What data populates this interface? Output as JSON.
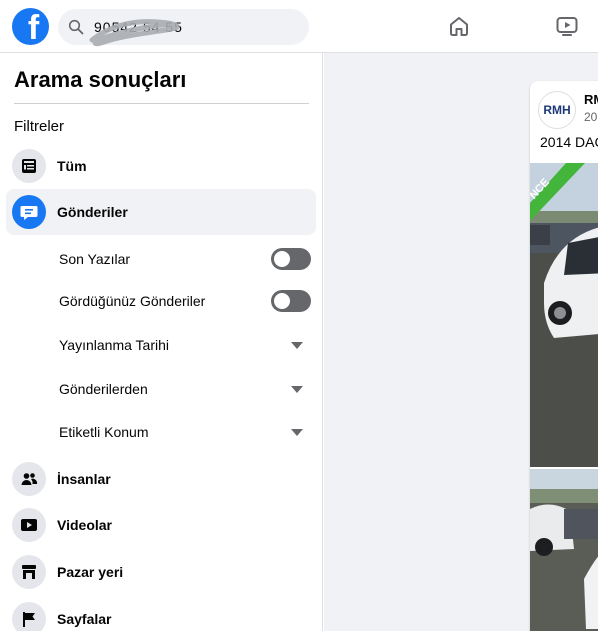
{
  "topbar": {
    "logo_letter": "f",
    "search_value": "90542 54 55"
  },
  "sidebar": {
    "title": "Arama sonuçları",
    "filters_label": "Filtreler",
    "categories": [
      {
        "label": "Tüm",
        "icon": "feed-icon"
      },
      {
        "label": "Gönderiler",
        "icon": "posts-icon",
        "active": true
      },
      {
        "label": "İnsanlar",
        "icon": "people-icon"
      },
      {
        "label": "Videolar",
        "icon": "video-icon"
      },
      {
        "label": "Pazar yeri",
        "icon": "marketplace-icon"
      },
      {
        "label": "Sayfalar",
        "icon": "flag-icon"
      }
    ],
    "sub_filters": [
      {
        "label": "Son Yazılar",
        "control": "toggle",
        "on": false
      },
      {
        "label": "Gördüğünüz Gönderiler",
        "control": "toggle",
        "on": false
      },
      {
        "label": "Yayınlanma Tarihi",
        "control": "dropdown"
      },
      {
        "label": "Gönderilerden",
        "control": "dropdown"
      },
      {
        "label": "Etiketli Konum",
        "control": "dropdown"
      }
    ]
  },
  "post": {
    "avatar_text": "RMH",
    "author": "RM",
    "date": "20",
    "text": "2014 DAC",
    "banner_text": "NCE"
  },
  "colors": {
    "brand": "#1877f2",
    "toggle_off": "#65676b",
    "background": "#f0f2f5"
  }
}
